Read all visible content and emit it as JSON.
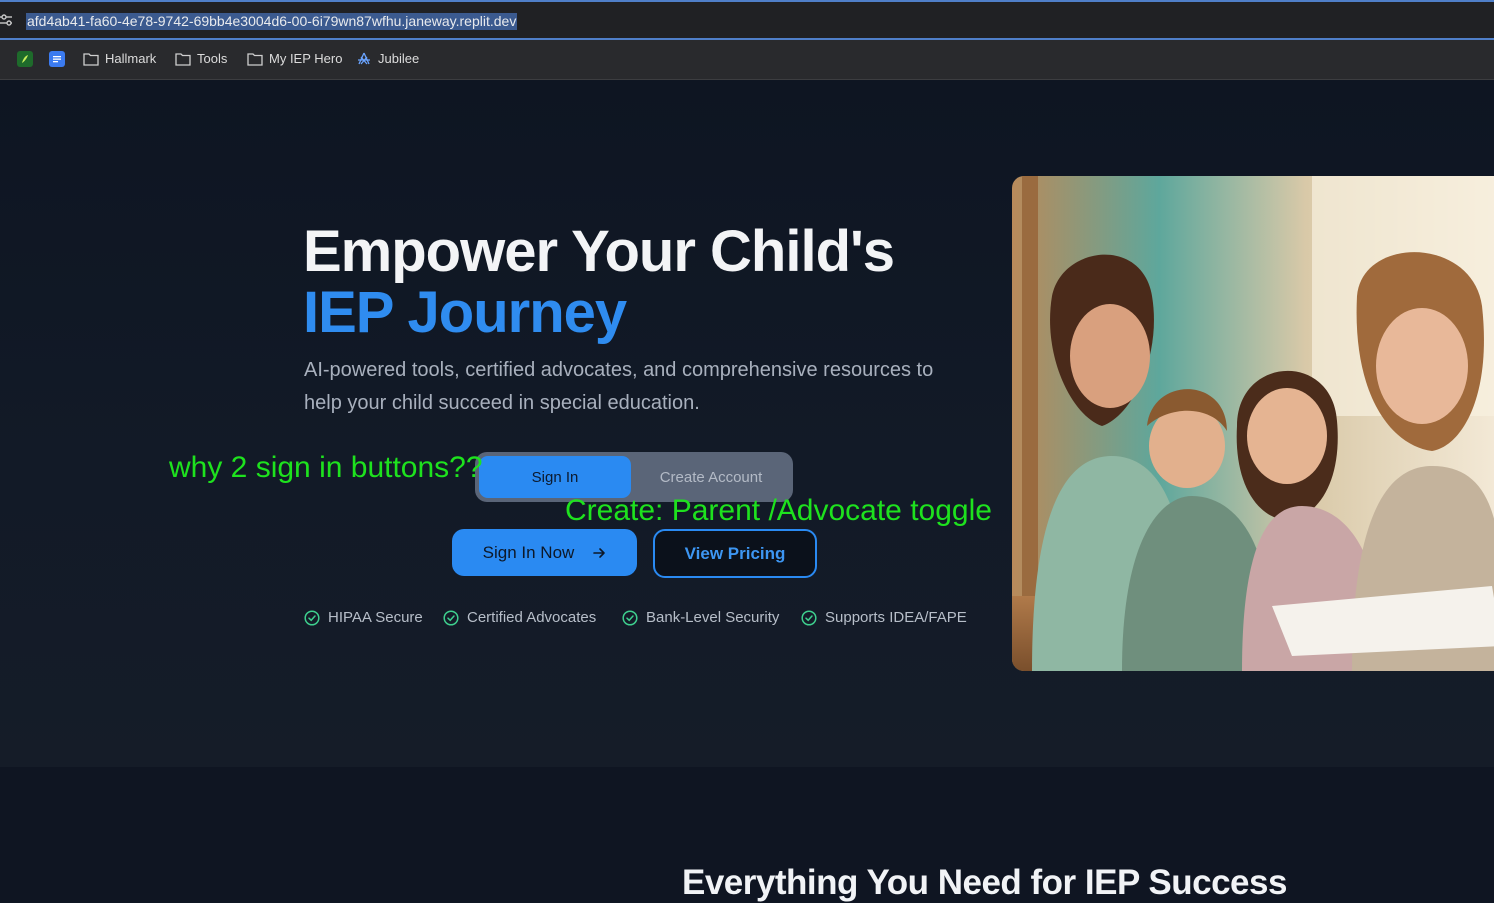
{
  "browser": {
    "url": "afd4ab41-fa60-4e78-9742-69bb4e3004d6-00-6i79wn87wfhu.janeway.replit.dev",
    "bookmarks": [
      {
        "label": "Hallmark",
        "icon": "folder-icon"
      },
      {
        "label": "Tools",
        "icon": "folder-icon"
      },
      {
        "label": "My IEP Hero",
        "icon": "folder-icon"
      },
      {
        "label": "Jubilee",
        "icon": "jubilee-icon"
      }
    ]
  },
  "hero": {
    "title_line1": "Empower Your Child's",
    "title_line2": "IEP Journey",
    "subtitle": "AI-powered tools, certified advocates, and comprehensive resources to help your child succeed in special education.",
    "toggle": {
      "signin": "Sign In",
      "create": "Create Account",
      "selected": "Sign In"
    },
    "primary_button": "Sign In Now",
    "secondary_button": "View Pricing",
    "trust_badges": [
      "HIPAA Secure",
      "Certified Advocates",
      "Bank-Level Security",
      "Supports IDEA/FAPE"
    ]
  },
  "annotations": {
    "note1": "why 2 sign in buttons??",
    "note2": "Create: Parent /Advocate toggle"
  },
  "section2": {
    "title": "Everything You Need for IEP Success"
  },
  "colors": {
    "accent": "#2a8af2",
    "annotation": "#1ee21e",
    "background": "#0f1623"
  }
}
